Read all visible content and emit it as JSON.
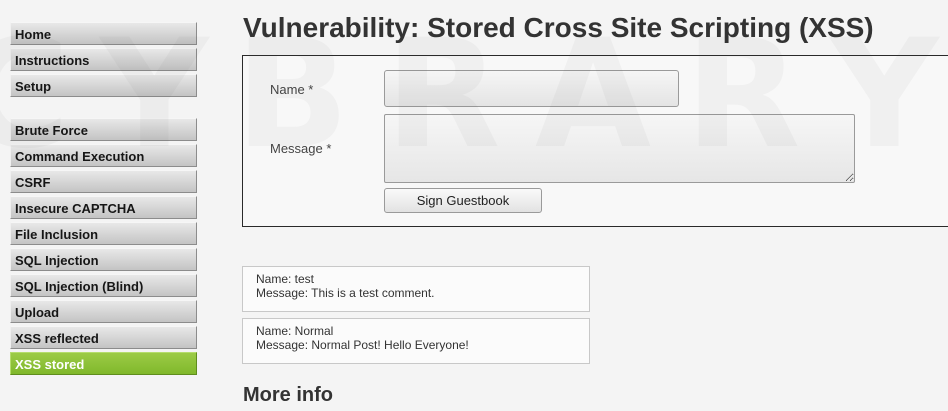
{
  "watermark": "CYBRARY",
  "sidebar": {
    "group1": [
      {
        "label": "Home"
      },
      {
        "label": "Instructions"
      },
      {
        "label": "Setup"
      }
    ],
    "group2": [
      {
        "label": "Brute Force"
      },
      {
        "label": "Command Execution"
      },
      {
        "label": "CSRF"
      },
      {
        "label": "Insecure CAPTCHA"
      },
      {
        "label": "File Inclusion"
      },
      {
        "label": "SQL Injection"
      },
      {
        "label": "SQL Injection (Blind)"
      },
      {
        "label": "Upload"
      },
      {
        "label": "XSS reflected"
      },
      {
        "label": "XSS stored"
      }
    ],
    "active_item": "XSS stored",
    "active_color": "#8bc13a"
  },
  "page": {
    "title": "Vulnerability: Stored Cross Site Scripting (XSS)"
  },
  "form": {
    "name_label": "Name *",
    "name_value": "",
    "message_label": "Message *",
    "message_value": "",
    "submit_label": "Sign Guestbook"
  },
  "guestbook": {
    "entries": [
      {
        "name": "Name: test",
        "message": "Message: This is a test comment."
      },
      {
        "name": "Name: Normal",
        "message": "Message: Normal Post! Hello Everyone!"
      }
    ]
  },
  "more_info": {
    "heading": "More info"
  }
}
